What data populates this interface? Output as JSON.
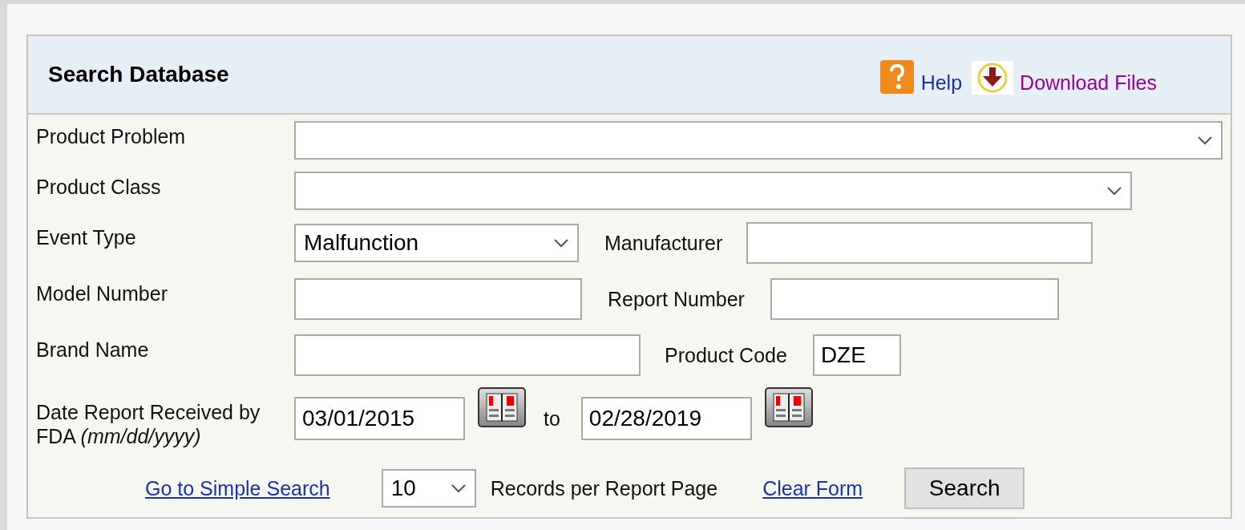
{
  "panel": {
    "title": "Search Database",
    "links": [
      {
        "label": "Help",
        "kind": "help"
      },
      {
        "label": "Download Files",
        "kind": "download"
      }
    ]
  },
  "rows": [
    {
      "label": "Product Problem",
      "fields": [
        {
          "kind": "select"
        }
      ]
    },
    {
      "label": "Product Class",
      "fields": [
        {
          "kind": "select"
        }
      ]
    },
    {
      "label": "Event Type",
      "fields": [
        {
          "kind": "select",
          "value": "Malfunction"
        },
        {
          "kind": "text",
          "label": "Manufacturer"
        }
      ]
    },
    {
      "label": "Model Number",
      "fields": [
        {
          "kind": "text"
        },
        {
          "kind": "text",
          "label": "Report Number"
        }
      ]
    },
    {
      "label": "Brand Name",
      "fields": [
        {
          "kind": "text"
        },
        {
          "kind": "text",
          "label": "Product Code",
          "value": "DZE"
        }
      ]
    },
    {
      "label": "Date Report Received by FDA *(mm/dd/yyyy)*",
      "fields": [
        {
          "kind": "date",
          "value": "03/01/2015"
        },
        {
          "kind": "date",
          "label": "to",
          "value": "02/28/2019"
        }
      ]
    }
  ],
  "footer": {
    "simple_search_link": "Go to Simple Search",
    "records_select": "10",
    "records_label": "Records per Report Page",
    "clear_link": "Clear Form",
    "search_button": "Search"
  }
}
